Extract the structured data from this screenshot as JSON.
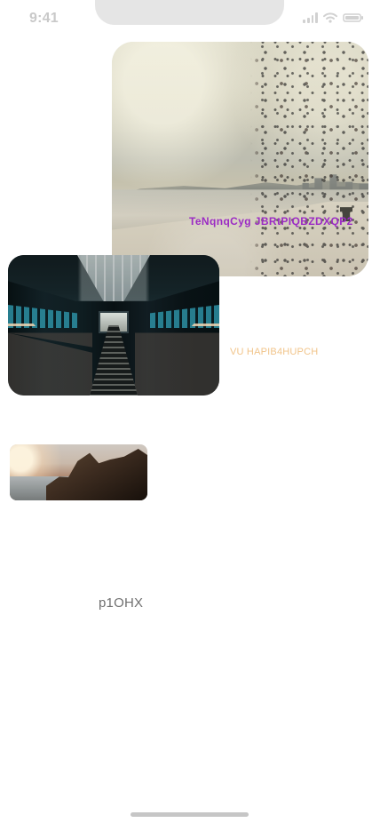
{
  "status_bar": {
    "time": "9:41",
    "icons": [
      "signal-icon",
      "wifi-icon",
      "battery-icon"
    ]
  },
  "gallery": {
    "images": [
      {
        "name": "beach-scene",
        "caption": "TeNqnqCyg JBRtPIQBZDXQP2",
        "caption_color": "#9b2bc4"
      },
      {
        "name": "escalator-scene"
      },
      {
        "name": "coastal-cliff-scene"
      }
    ],
    "faint_text": "VU HAPIB4HUPCH",
    "faint_text_color": "#f1c48a"
  },
  "footer": {
    "code": "p1OHX"
  }
}
